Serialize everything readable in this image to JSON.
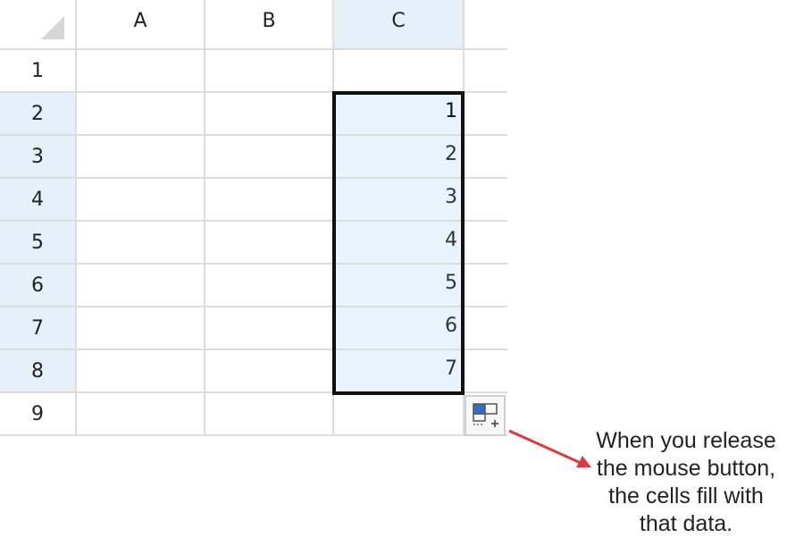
{
  "columns": [
    "A",
    "B",
    "C"
  ],
  "active_column": "C",
  "rows": [
    "1",
    "2",
    "3",
    "4",
    "5",
    "6",
    "7",
    "8",
    "9"
  ],
  "active_rows": [
    "2",
    "3",
    "4",
    "5",
    "6",
    "7",
    "8"
  ],
  "column_c_values": [
    "",
    "1",
    "2",
    "3",
    "4",
    "5",
    "6",
    "7",
    ""
  ],
  "autofill_options_icon": "autofill-options-icon",
  "callout": {
    "lines": [
      "When you release",
      "the mouse button,",
      "the cells fill with",
      "that data."
    ]
  },
  "colors": {
    "selection_fill": "#e8f3fd",
    "header_highlight": "#e6f0f8",
    "selection_border": "#111111",
    "arrow": "#e0383b"
  }
}
